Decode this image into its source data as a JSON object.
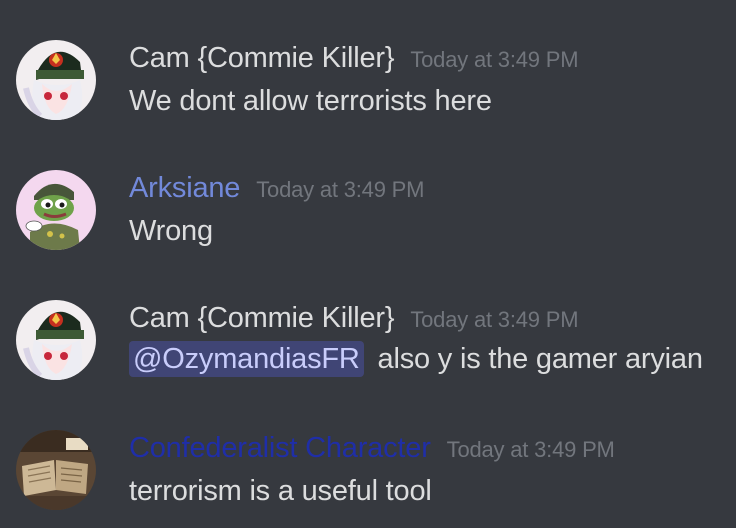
{
  "messages": [
    {
      "author": "Cam {Commie Killer}",
      "author_color": "#dcddde",
      "timestamp": "Today at 3:49 PM",
      "text": "We dont allow terrorists here",
      "avatar": "officer-avatar-icon"
    },
    {
      "author": "Arksiane",
      "author_color": "#7289da",
      "timestamp": "Today at 3:49 PM",
      "text": "Wrong",
      "avatar": "frog-soldier-avatar-icon"
    },
    {
      "author": "Cam {Commie Killer}",
      "author_color": "#dcddde",
      "timestamp": "Today at 3:49 PM",
      "mention": "@OzymandiasFR",
      "text": "also y is the gamer aryian",
      "avatar": "officer-avatar-icon"
    },
    {
      "author": "Confederalist Character",
      "author_color": "#1f2ea8",
      "timestamp": "Today at 3:49 PM",
      "text": "terrorism is a useful tool",
      "avatar": "books-avatar-icon"
    }
  ]
}
